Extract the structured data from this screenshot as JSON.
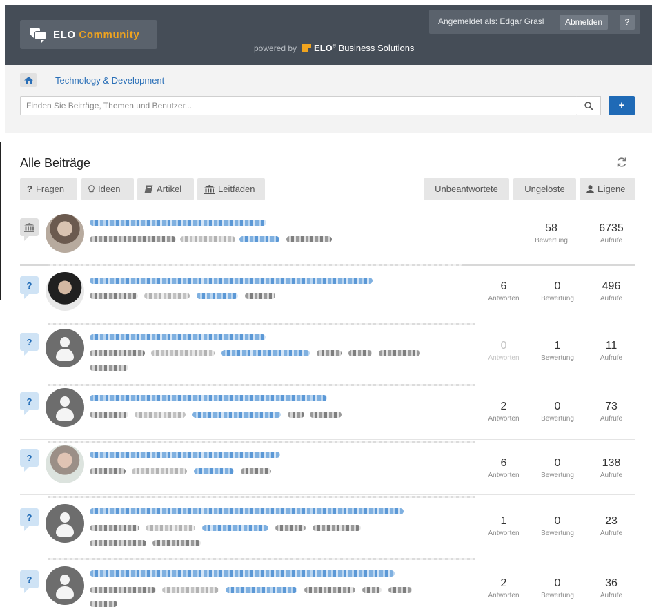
{
  "header": {
    "logo": {
      "word1": "ELO",
      "word2": "Community"
    },
    "powered_by": "powered by",
    "brand_bold": "ELO",
    "brand_rest": "Business Solutions",
    "logged_in_as": "Angemeldet als: Edgar Grasl",
    "logout_label": "Abmelden",
    "help_label": "?"
  },
  "breadcrumb": {
    "home_icon": "home-icon",
    "current": "Technology & Development"
  },
  "search": {
    "placeholder": "Finden Sie Beiträge, Themen und Benutzer...",
    "value": ""
  },
  "new_post": {
    "label": "+"
  },
  "section": {
    "title": "Alle Beiträge"
  },
  "filters": {
    "questions": "Fragen",
    "ideas": "Ideen",
    "articles": "Artikel",
    "guides": "Leitfäden",
    "unanswered": "Unbeantwortete",
    "unsolved": "Ungelöste",
    "own": "Eigene"
  },
  "stat_labels": {
    "answers": "Antworten",
    "rating": "Bewertung",
    "views": "Aufrufe"
  },
  "posts": [
    {
      "type": "guide",
      "answers": "",
      "rating": "58",
      "views": "6735"
    },
    {
      "type": "question",
      "answers": "6",
      "rating": "0",
      "views": "496"
    },
    {
      "type": "question",
      "answers": "0",
      "rating": "1",
      "views": "11"
    },
    {
      "type": "question",
      "answers": "2",
      "rating": "0",
      "views": "73"
    },
    {
      "type": "question",
      "answers": "6",
      "rating": "0",
      "views": "138"
    },
    {
      "type": "question",
      "answers": "1",
      "rating": "0",
      "views": "23"
    },
    {
      "type": "question",
      "answers": "2",
      "rating": "0",
      "views": "36"
    }
  ],
  "colors": {
    "header_bg": "#454d57",
    "accent_blue": "#1f6ab6",
    "brand_orange": "#f0a41f"
  }
}
